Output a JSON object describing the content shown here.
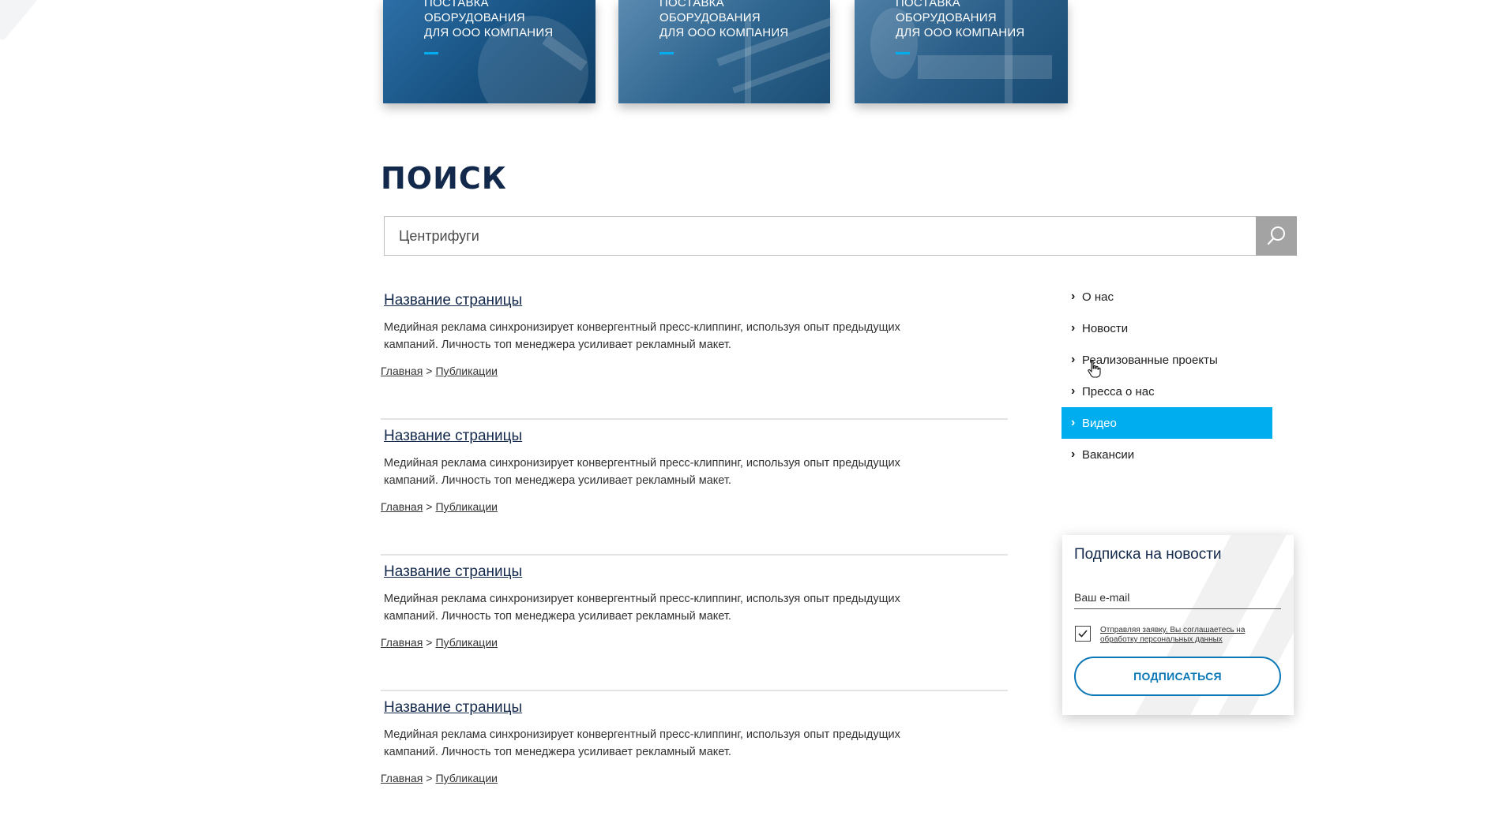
{
  "cards": [
    {
      "lines": [
        "ПОСТАВКА",
        "ОБОРУДОВАНИЯ",
        "ДЛЯ ООО КОМПАНИЯ"
      ]
    },
    {
      "lines": [
        "ПОСТАВКА",
        "ОБОРУДОВАНИЯ",
        "ДЛЯ ООО КОМПАНИЯ"
      ]
    },
    {
      "lines": [
        "ПОСТАВКА",
        "ОБОРУДОВАНИЯ",
        "ДЛЯ ООО КОМПАНИЯ"
      ]
    }
  ],
  "search": {
    "title": "ПОИСК",
    "value": "Центрифуги",
    "button_icon": "search-icon"
  },
  "results": [
    {
      "title": "Название страницы",
      "description": "Медийная реклама синхронизирует конвергентный пресс-клиппинг, используя опыт предыдущих кампаний. Личность топ менеджера усиливает рекламный макет.",
      "crumb_home": "Главная",
      "crumb_sep": ">",
      "crumb_section": "Публикации"
    },
    {
      "title": "Название страницы",
      "description": "Медийная реклама синхронизирует конвергентный пресс-клиппинг, используя опыт предыдущих кампаний. Личность топ менеджера усиливает рекламный макет.",
      "crumb_home": "Главная",
      "crumb_sep": ">",
      "crumb_section": "Публикации"
    },
    {
      "title": "Название страницы",
      "description": "Медийная реклама синхронизирует конвергентный пресс-клиппинг, используя опыт предыдущих кампаний. Личность топ менеджера усиливает рекламный макет.",
      "crumb_home": "Главная",
      "crumb_sep": ">",
      "crumb_section": "Публикации"
    },
    {
      "title": "Название страницы",
      "description": "Медийная реклама синхронизирует конвергентный пресс-клиппинг, используя опыт предыдущих кампаний. Личность топ менеджера усиливает рекламный макет.",
      "crumb_home": "Главная",
      "crumb_sep": ">",
      "crumb_section": "Публикации"
    }
  ],
  "side_nav": {
    "chevron_icon": "chevron-right-icon",
    "items": [
      {
        "label": "О нас"
      },
      {
        "label": "Новости"
      },
      {
        "label": "Реализованные проекты"
      },
      {
        "label": "Пресса о нас"
      },
      {
        "label": "Видео",
        "active": true
      },
      {
        "label": "Вакансии"
      }
    ]
  },
  "subscribe": {
    "title": "Подписка на новости",
    "email_placeholder": "Ваш e-mail",
    "consent_checked": true,
    "consent_text": "Отправляя заявку, Вы соглашаетесь на обработку персональных данных",
    "button_label": "ПОДПИСАТЬСЯ"
  },
  "colors": {
    "accent": "#00aeef",
    "heading": "#13294b",
    "button_border": "#0a78b6",
    "search_button": "#a3a3a3"
  }
}
